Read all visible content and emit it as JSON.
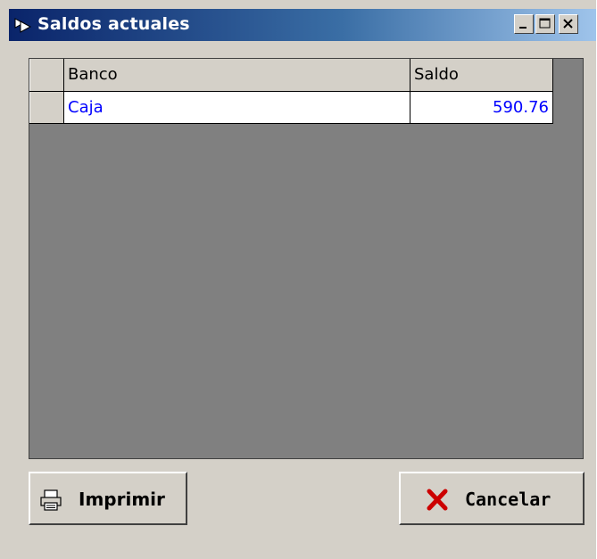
{
  "window": {
    "title": "Saldos actuales",
    "controls": {
      "minimize": "minimize",
      "maximize": "maximize",
      "close": "close"
    }
  },
  "grid": {
    "columns": [
      "Banco",
      "Saldo"
    ],
    "rows": [
      {
        "banco": "Caja",
        "saldo": "590.76"
      }
    ],
    "row_text_color": "#0000ff",
    "empty_area_color": "#808080"
  },
  "buttons": {
    "print_label": "Imprimir",
    "cancel_label": "Cancelar"
  },
  "icons": {
    "title": "dialog-icon",
    "print": "printer-icon",
    "cancel": "red-x-icon"
  }
}
